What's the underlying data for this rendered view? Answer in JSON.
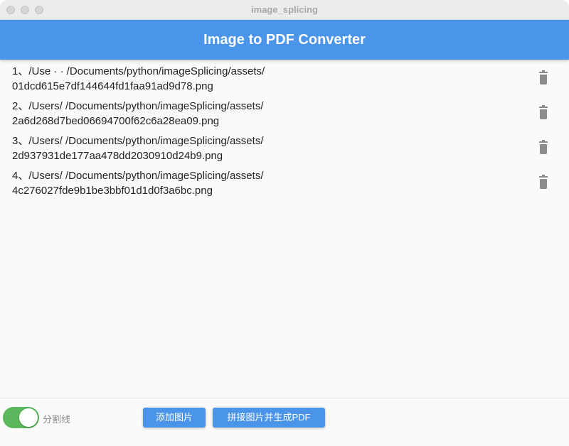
{
  "window": {
    "title": "image_splicing"
  },
  "appbar": {
    "title": "Image to PDF Converter"
  },
  "files": [
    {
      "label": "1、/Use    ·  ·  /Documents/python/imageSplicing/assets/\n01dcd615e7df144644fd1faa91ad9d78.png"
    },
    {
      "label": "2、/Users/       /Documents/python/imageSplicing/assets/\n2a6d268d7bed06694700f62c6a28ea09.png"
    },
    {
      "label": "3、/Users/       /Documents/python/imageSplicing/assets/\n2d937931de177aa478dd2030910d24b9.png"
    },
    {
      "label": "4、/Users/       /Documents/python/imageSplicing/assets/\n4c276027fde9b1be3bbf01d1d0f3a6bc.png"
    }
  ],
  "icons": {
    "delete": "trash-icon"
  },
  "bottom": {
    "toggle_label": "分割线",
    "toggle_on": true,
    "add_button": "添加图片",
    "generate_button": "拼接图片并生成PDF"
  },
  "colors": {
    "primary": "#4a95ea",
    "toggle_on": "#5cb85c",
    "icon": "#8c8c8c"
  }
}
